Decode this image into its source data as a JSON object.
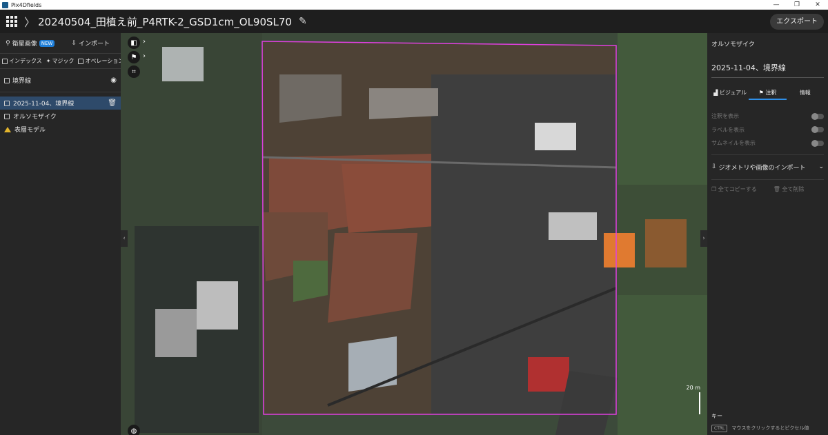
{
  "window": {
    "app_name": "Pix4Dfields",
    "controls": [
      "—",
      "❐",
      "✕"
    ]
  },
  "header": {
    "project_title": "20240504_田植え前_P4RTK-2_GSD1cm_OL90SL70",
    "export_label": "エクスポート"
  },
  "left_panel": {
    "satellite_label": "衛星画像",
    "new_badge": "NEW",
    "import_label": "インポート",
    "tools": [
      "インデックス",
      "マジック",
      "オペレーション"
    ],
    "boundary_header": "境界線",
    "layers": [
      {
        "label": "2025-11-04、境界線",
        "selected": true
      },
      {
        "label": "オルソモザイク",
        "selected": false
      },
      {
        "label": "表層モデル",
        "selected": false
      }
    ]
  },
  "map": {
    "scale_label": "20 m",
    "boundary_color": "#e040e0"
  },
  "right_panel": {
    "title": "オルソモザイク",
    "layer_name": "2025-11-04、境界線",
    "tabs": [
      "ビジュアル",
      "注釈",
      "情報"
    ],
    "active_tab": "注釈",
    "toggles": [
      "注釈を表示",
      "ラベルを表示",
      "サムネイルを表示"
    ],
    "import_section": "ジオメトリや画像のインポート",
    "copy_all": "全てコピーする",
    "delete_all": "全て削除",
    "key_label": "キー",
    "ctrl_key": "CTRL",
    "ctrl_hint": "マウスをクリックするとピクセル値"
  }
}
